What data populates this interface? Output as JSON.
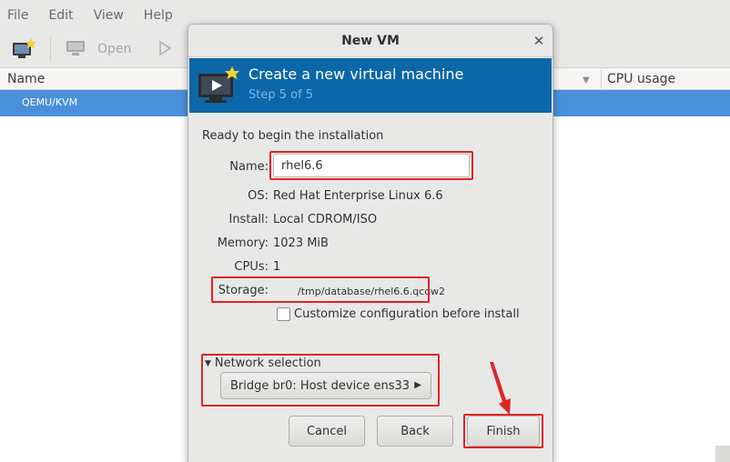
{
  "menu": {
    "items": [
      "File",
      "Edit",
      "View",
      "Help"
    ]
  },
  "toolbar": {
    "open_label": "Open"
  },
  "list": {
    "col_name": "Name",
    "col_cpu": "CPU usage",
    "connection": "QEMU/KVM"
  },
  "dialog": {
    "title": "New VM",
    "banner_title": "Create a new virtual machine",
    "banner_step": "Step 5 of 5",
    "ready_text": "Ready to begin the installation",
    "fields": {
      "name_label": "Name:",
      "name_value": "rhel6.6",
      "os_label": "OS:",
      "os_value": "Red Hat Enterprise Linux 6.6",
      "install_label": "Install:",
      "install_value": "Local CDROM/ISO",
      "memory_label": "Memory:",
      "memory_value": "1023 MiB",
      "cpus_label": "CPUs:",
      "cpus_value": "1",
      "storage_label": "Storage:",
      "storage_value": "/tmp/database/rhel6.6.qcow2"
    },
    "customize_label": "Customize configuration before install",
    "customize_checked": false,
    "network_label": "Network selection",
    "network_value": "Bridge br0: Host device ens33",
    "buttons": {
      "cancel": "Cancel",
      "back": "Back",
      "finish": "Finish"
    }
  },
  "colors": {
    "selection": "#4a90d9",
    "banner": "#0c67a8",
    "highlight": "#e02424"
  }
}
